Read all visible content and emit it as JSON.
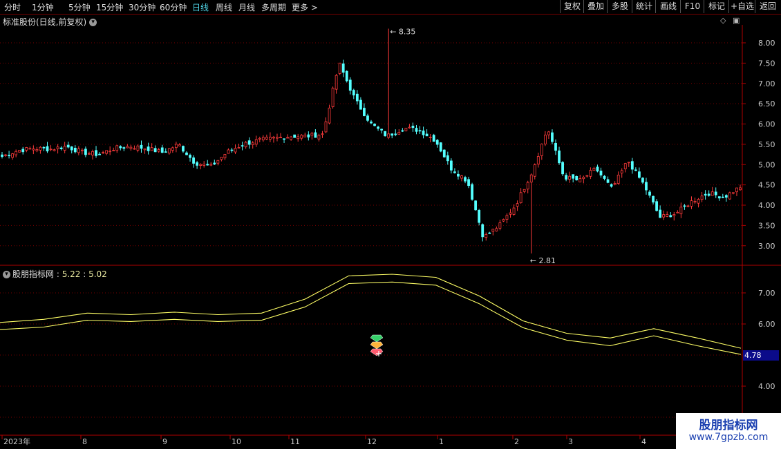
{
  "toolbar": {
    "periods": [
      "分时",
      "1分钟",
      "5分钟",
      "15分钟",
      "30分钟",
      "60分钟",
      "日线",
      "周线",
      "月线",
      "多周期",
      "更多"
    ],
    "active_period": "日线",
    "buttons": [
      "复权",
      "叠加",
      "多股",
      "统计",
      "画线",
      "F10",
      "标记",
      "+自选",
      "返回"
    ]
  },
  "main_chart": {
    "title": "标准股份(日线,前复权)",
    "high_label": "8.35",
    "low_label": "2.81",
    "y_ticks": [
      "8.00",
      "7.50",
      "7.00",
      "6.50",
      "6.00",
      "5.50",
      "5.00",
      "4.50",
      "4.00",
      "3.50",
      "3.00"
    ]
  },
  "indicator": {
    "name": "股朋指标网",
    "value1": "5.22",
    "value2": "5.02",
    "y_ticks": [
      "7.00",
      "6.00",
      "4.00"
    ],
    "last_value": "4.78"
  },
  "x_axis": {
    "labels": [
      "2023年",
      "8",
      "9",
      "10",
      "11",
      "12",
      "1",
      "2",
      "3",
      "4"
    ]
  },
  "watermark": {
    "title": "股朋指标网",
    "url": "www.7gpzb.com"
  },
  "colors": {
    "up": "#ff3b3b",
    "down": "#54ffff",
    "indicator_line": "#ffff66",
    "grid": "#7a0000",
    "axis": "#b00000"
  },
  "chart_data": [
    {
      "type": "candlestick",
      "title": "标准股份(日线,前复权)",
      "x_labels": [
        "2023年",
        "8",
        "9",
        "10",
        "11",
        "12",
        "1",
        "2",
        "3",
        "4"
      ],
      "ylim": [
        2.7,
        8.4
      ],
      "annotations": {
        "high": 8.35,
        "low": 2.81
      },
      "approx_close_path": [
        5.2,
        5.35,
        5.4,
        5.38,
        5.45,
        5.3,
        5.25,
        5.4,
        5.45,
        5.4,
        5.3,
        5.5,
        5.05,
        4.95,
        5.3,
        5.5,
        5.6,
        5.65,
        5.7,
        5.7,
        5.75,
        7.5,
        6.6,
        6.0,
        5.7,
        5.9,
        5.85,
        5.6,
        4.9,
        4.6,
        3.2,
        3.5,
        4.0,
        4.8,
        5.9,
        4.7,
        4.6,
        4.9,
        4.4,
        5.1,
        4.5,
        3.7,
        3.8,
        4.1,
        4.3,
        4.2,
        4.45
      ]
    },
    {
      "type": "line",
      "title": "股朋指标网",
      "series": [
        {
          "name": "5.22",
          "values": [
            6.05,
            6.15,
            6.35,
            6.3,
            6.38,
            6.3,
            6.35,
            6.8,
            7.55,
            7.6,
            7.5,
            6.9,
            6.1,
            5.7,
            5.55,
            5.85,
            5.55,
            5.22
          ]
        },
        {
          "name": "5.02",
          "values": [
            5.82,
            5.9,
            6.12,
            6.08,
            6.15,
            6.08,
            6.12,
            6.55,
            7.3,
            7.35,
            7.25,
            6.65,
            5.88,
            5.48,
            5.3,
            5.62,
            5.3,
            5.02
          ]
        }
      ],
      "ylim": [
        3.0,
        8.0
      ],
      "last_value": 4.78
    }
  ]
}
